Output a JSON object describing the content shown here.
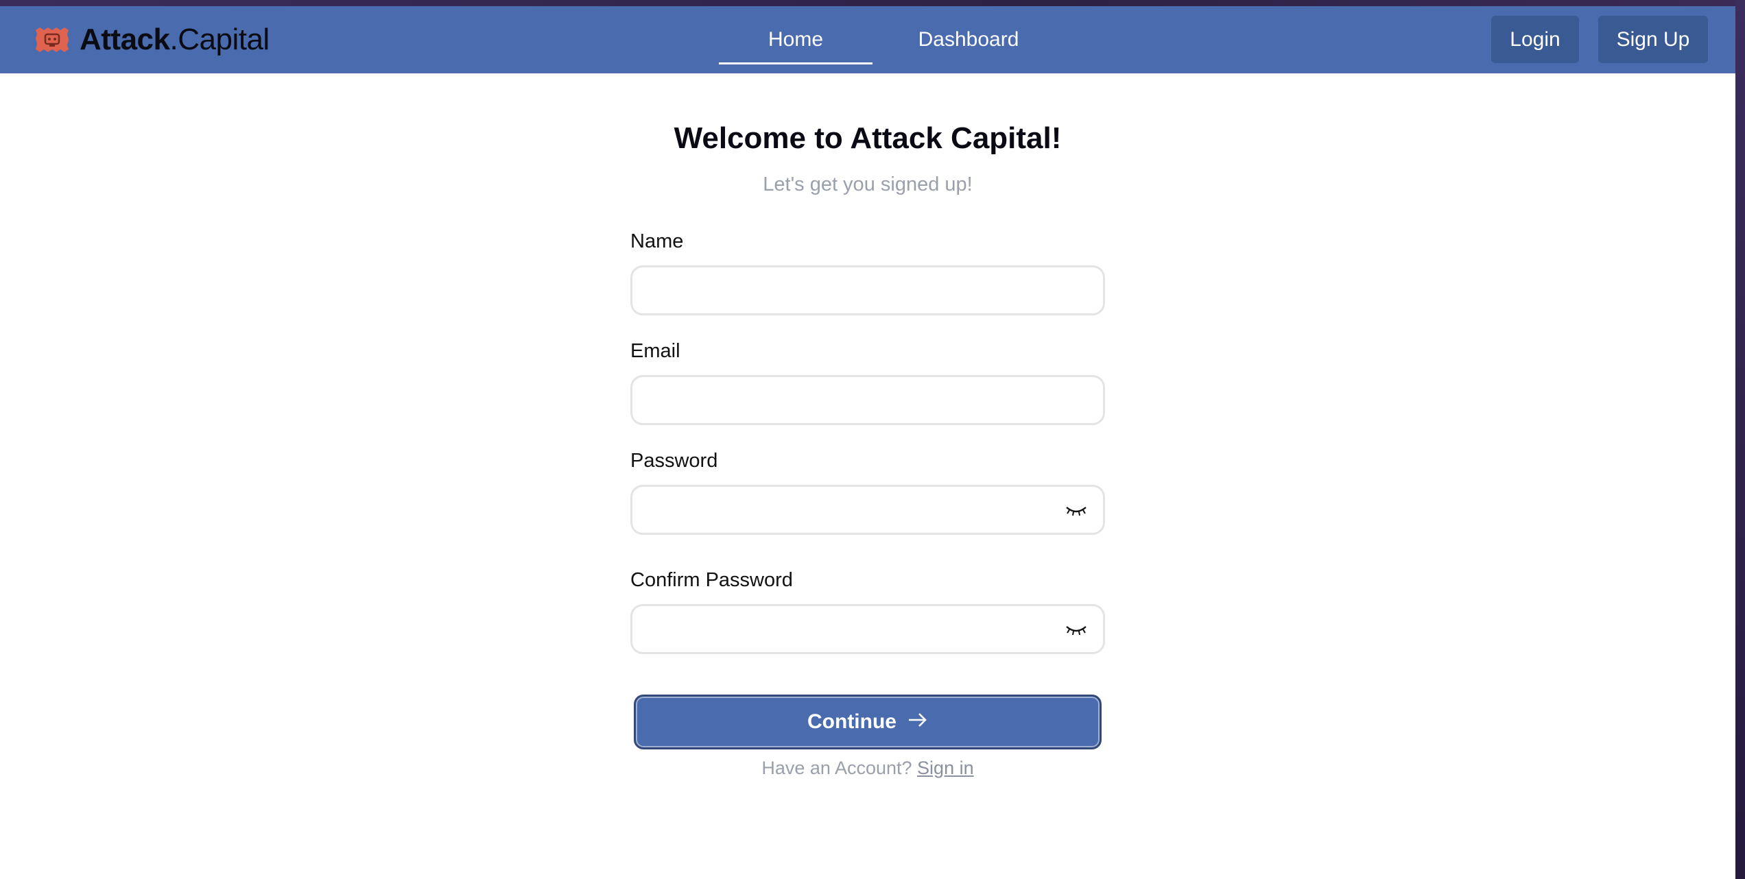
{
  "brand": {
    "name_bold": "Attack",
    "name_regular": ".Capital",
    "logo_color": "#e0634f"
  },
  "nav": {
    "links": [
      {
        "label": "Home",
        "active": true
      },
      {
        "label": "Dashboard",
        "active": false
      }
    ],
    "login_label": "Login",
    "signup_label": "Sign Up"
  },
  "form": {
    "title": "Welcome to Attack Capital!",
    "subtitle": "Let's get you signed up!",
    "name_label": "Name",
    "name_value": "",
    "email_label": "Email",
    "email_value": "",
    "password_label": "Password",
    "password_value": "",
    "password_toggle_icon": "eye-closed-icon",
    "confirm_label": "Confirm Password",
    "confirm_value": "",
    "confirm_toggle_icon": "eye-closed-icon",
    "continue_label": "Continue",
    "continue_icon": "arrow-right-icon",
    "have_account_text": "Have an Account?",
    "signin_link": "Sign in"
  },
  "colors": {
    "navbar": "#4a6bae",
    "nav_button": "#3a5a94",
    "primary_button": "#4a6bae",
    "muted_text": "#9aa0ab"
  }
}
